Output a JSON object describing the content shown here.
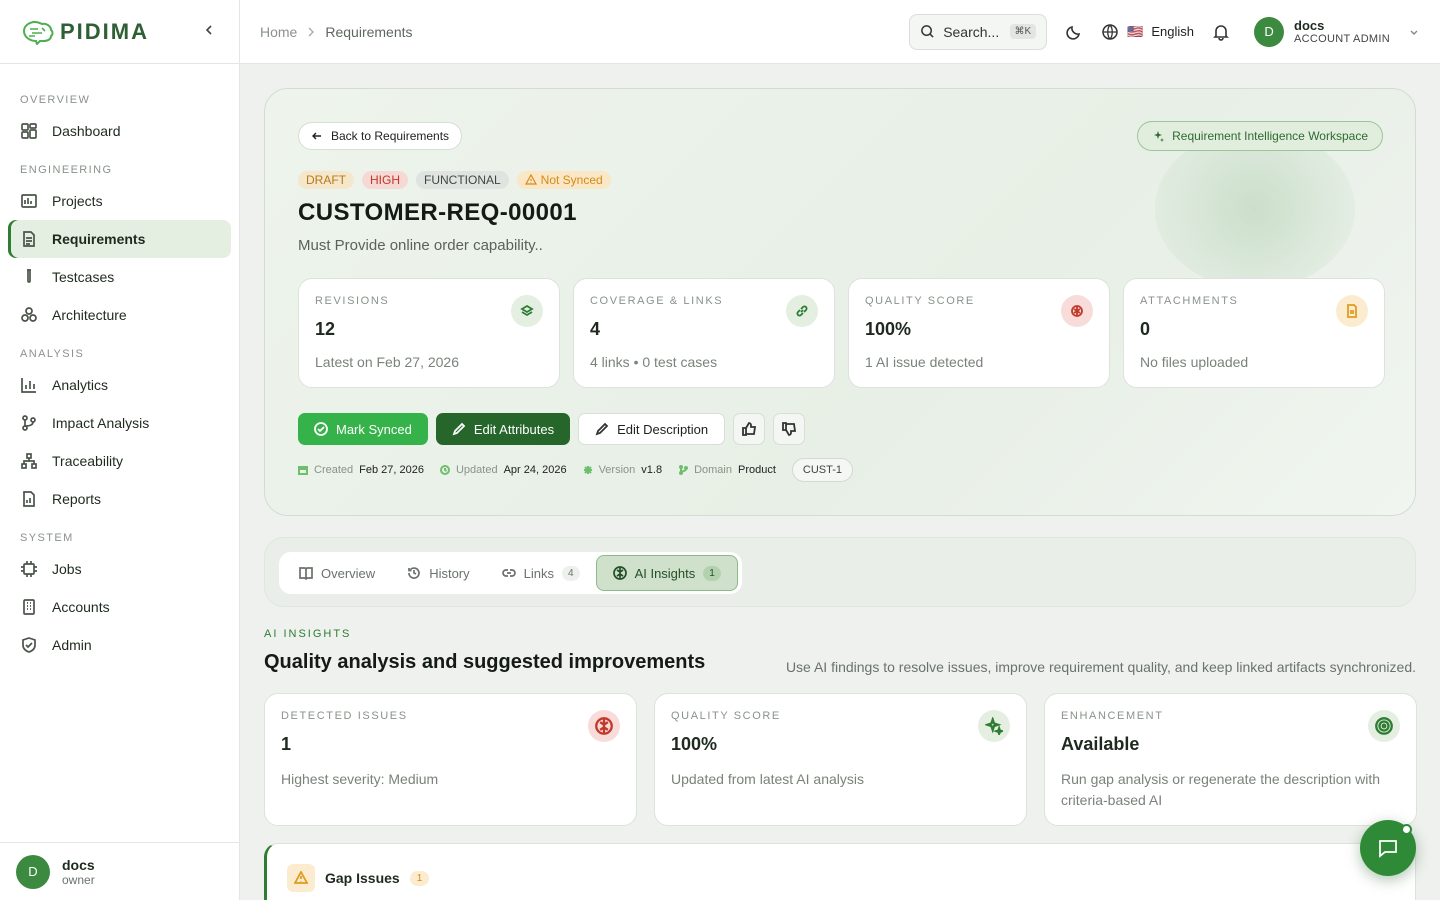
{
  "brand": {
    "name": "PIDIMA"
  },
  "sidebar": {
    "sections": [
      {
        "label": "OVERVIEW",
        "items": [
          {
            "label": "Dashboard",
            "icon": "dashboard-icon"
          }
        ]
      },
      {
        "label": "ENGINEERING",
        "items": [
          {
            "label": "Projects",
            "icon": "projects-icon"
          },
          {
            "label": "Requirements",
            "icon": "requirements-icon",
            "active": true
          },
          {
            "label": "Testcases",
            "icon": "testcases-icon"
          },
          {
            "label": "Architecture",
            "icon": "architecture-icon"
          }
        ]
      },
      {
        "label": "ANALYSIS",
        "items": [
          {
            "label": "Analytics",
            "icon": "analytics-icon"
          },
          {
            "label": "Impact Analysis",
            "icon": "impact-icon"
          },
          {
            "label": "Traceability",
            "icon": "traceability-icon"
          },
          {
            "label": "Reports",
            "icon": "reports-icon"
          }
        ]
      },
      {
        "label": "SYSTEM",
        "items": [
          {
            "label": "Jobs",
            "icon": "jobs-icon"
          },
          {
            "label": "Accounts",
            "icon": "accounts-icon"
          },
          {
            "label": "Admin",
            "icon": "admin-icon"
          }
        ]
      }
    ],
    "user": {
      "initial": "D",
      "name": "docs",
      "role": "owner"
    }
  },
  "topbar": {
    "breadcrumb": [
      "Home",
      "Requirements"
    ],
    "search_placeholder": "Search...",
    "search_shortcut": "⌘K",
    "language": "English",
    "language_flag": "🇺🇸",
    "user": {
      "initial": "D",
      "name": "docs",
      "role": "ACCOUNT ADMIN"
    }
  },
  "hero": {
    "back_label": "Back to Requirements",
    "workspace_label": "Requirement Intelligence Workspace",
    "badges": {
      "status": "DRAFT",
      "priority": "HIGH",
      "type": "FUNCTIONAL",
      "sync": "Not Synced"
    },
    "title": "CUSTOMER-REQ-00001",
    "description": "Must Provide online order capability..",
    "stats": [
      {
        "label": "REVISIONS",
        "value": "12",
        "sub": "Latest on Feb 27, 2026",
        "icon": "layers-icon",
        "color": "#2e7d32",
        "bg": "#e4efe1"
      },
      {
        "label": "COVERAGE & LINKS",
        "value": "4",
        "sub": "4 links • 0 test cases",
        "icon": "link-icon",
        "color": "#2e7d32",
        "bg": "#e4efe1"
      },
      {
        "label": "QUALITY SCORE",
        "value": "100%",
        "sub": "1 AI issue detected",
        "icon": "brain-icon",
        "color": "#c0392b",
        "bg": "#f8dcda"
      },
      {
        "label": "ATTACHMENTS",
        "value": "0",
        "sub": "No files uploaded",
        "icon": "file-icon",
        "color": "#e09b1e",
        "bg": "#fbecd0"
      }
    ],
    "actions": {
      "mark_synced": "Mark Synced",
      "edit_attributes": "Edit Attributes",
      "edit_description": "Edit Description"
    },
    "meta": {
      "created_label": "Created",
      "created": "Feb 27, 2026",
      "updated_label": "Updated",
      "updated": "Apr 24, 2026",
      "version_label": "Version",
      "version": "v1.8",
      "domain_label": "Domain",
      "domain": "Product",
      "tag": "CUST-1"
    }
  },
  "tabs": [
    {
      "label": "Overview",
      "icon": "book-icon"
    },
    {
      "label": "History",
      "icon": "history-icon"
    },
    {
      "label": "Links",
      "icon": "link-icon",
      "count": "4"
    },
    {
      "label": "AI Insights",
      "icon": "brain-icon",
      "count": "1",
      "active": true
    }
  ],
  "ai": {
    "eyebrow": "AI INSIGHTS",
    "title": "Quality analysis and suggested improvements",
    "subtitle": "Use AI findings to resolve issues, improve requirement quality, and keep linked artifacts synchronized.",
    "cards": [
      {
        "label": "DETECTED ISSUES",
        "value": "1",
        "sub": "Highest severity: Medium",
        "icon": "brain-icon",
        "color": "#c0392b",
        "bg": "#f8dcda"
      },
      {
        "label": "QUALITY SCORE",
        "value": "100%",
        "sub": "Updated from latest AI analysis",
        "icon": "sparkles-icon",
        "color": "#2e7d32",
        "bg": "#e4efe1"
      },
      {
        "label": "ENHANCEMENT",
        "value": "Available",
        "sub": "Run gap analysis or regenerate the description with criteria-based AI",
        "icon": "target-icon",
        "color": "#2e7d32",
        "bg": "#e4efe1"
      }
    ],
    "gap": {
      "title": "Gap Issues",
      "count": "1"
    }
  }
}
